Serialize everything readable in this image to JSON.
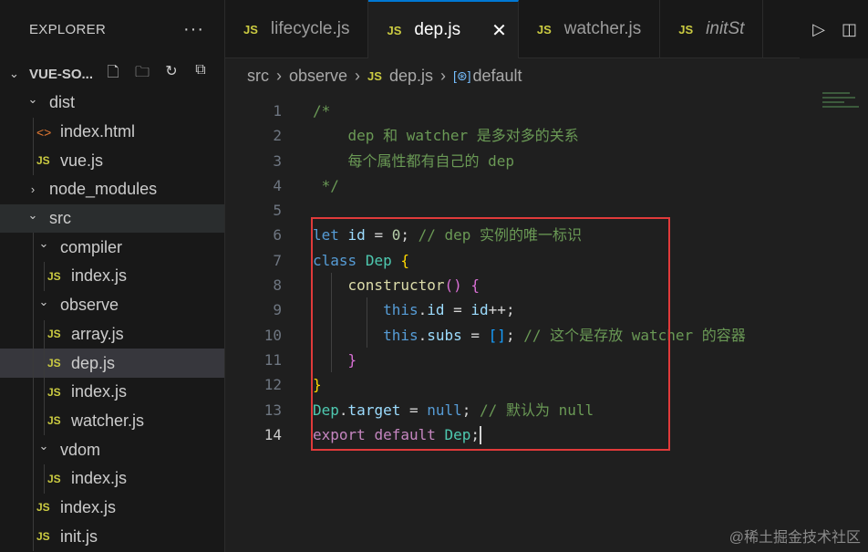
{
  "sidebar": {
    "title": "EXPLORER",
    "more": "···",
    "project": "VUE-SO...",
    "tree": [
      {
        "label": "dist",
        "type": "folder",
        "depth": 0,
        "open": true
      },
      {
        "label": "index.html",
        "type": "html",
        "depth": 1
      },
      {
        "label": "vue.js",
        "type": "js",
        "depth": 1
      },
      {
        "label": "node_modules",
        "type": "folder",
        "depth": 0,
        "open": false
      },
      {
        "label": "src",
        "type": "folder",
        "depth": 0,
        "open": true,
        "hover": true
      },
      {
        "label": "compiler",
        "type": "folder",
        "depth": 1,
        "open": true
      },
      {
        "label": "index.js",
        "type": "js",
        "depth": 2
      },
      {
        "label": "observe",
        "type": "folder",
        "depth": 1,
        "open": true
      },
      {
        "label": "array.js",
        "type": "js",
        "depth": 2
      },
      {
        "label": "dep.js",
        "type": "js",
        "depth": 2,
        "selected": true
      },
      {
        "label": "index.js",
        "type": "js",
        "depth": 2
      },
      {
        "label": "watcher.js",
        "type": "js",
        "depth": 2
      },
      {
        "label": "vdom",
        "type": "folder",
        "depth": 1,
        "open": true
      },
      {
        "label": "index.js",
        "type": "js",
        "depth": 2
      },
      {
        "label": "index.js",
        "type": "js",
        "depth": 1
      },
      {
        "label": "init.js",
        "type": "js",
        "depth": 1
      }
    ]
  },
  "tabs": [
    {
      "label": "lifecycle.js",
      "active": false
    },
    {
      "label": "dep.js",
      "active": true,
      "close": "✕"
    },
    {
      "label": "watcher.js",
      "active": false
    },
    {
      "label": "initSt",
      "active": false,
      "italic": true
    }
  ],
  "js_badge": "JS",
  "html_badge": "<>",
  "breadcrumb": {
    "parts": [
      "src",
      "observe",
      "dep.js"
    ],
    "symbol_icon": "[⊛]",
    "symbol": "default"
  },
  "editor": {
    "current_line": 14,
    "lines": [
      [
        [
          "c-com",
          "/*"
        ]
      ],
      [
        [
          "c-com",
          "    dep 和 watcher 是多对多的关系"
        ]
      ],
      [
        [
          "c-com",
          "    每个属性都有自己的 dep"
        ]
      ],
      [
        [
          "c-com",
          " */"
        ]
      ],
      [],
      [
        [
          "c-kw",
          "let"
        ],
        [
          "c-plain",
          " "
        ],
        [
          "c-var",
          "id"
        ],
        [
          "c-plain",
          " = "
        ],
        [
          "c-num",
          "0"
        ],
        [
          "c-plain",
          "; "
        ],
        [
          "c-com",
          "// dep 实例的唯一标识"
        ]
      ],
      [
        [
          "c-kw",
          "class"
        ],
        [
          "c-plain",
          " "
        ],
        [
          "c-cls",
          "Dep"
        ],
        [
          "c-plain",
          " "
        ],
        [
          "c-b1",
          "{"
        ]
      ],
      [
        [
          "c-plain",
          "    "
        ],
        [
          "c-fn",
          "constructor"
        ],
        [
          "c-b2",
          "()"
        ],
        [
          "c-plain",
          " "
        ],
        [
          "c-b2",
          "{"
        ]
      ],
      [
        [
          "c-plain",
          "        "
        ],
        [
          "c-kw",
          "this"
        ],
        [
          "c-plain",
          "."
        ],
        [
          "c-var",
          "id"
        ],
        [
          "c-plain",
          " = "
        ],
        [
          "c-var",
          "id"
        ],
        [
          "c-plain",
          "++;"
        ]
      ],
      [
        [
          "c-plain",
          "        "
        ],
        [
          "c-kw",
          "this"
        ],
        [
          "c-plain",
          "."
        ],
        [
          "c-var",
          "subs"
        ],
        [
          "c-plain",
          " = "
        ],
        [
          "c-b3",
          "[]"
        ],
        [
          "c-plain",
          "; "
        ],
        [
          "c-com",
          "// 这个是存放 watcher 的容器"
        ]
      ],
      [
        [
          "c-plain",
          "    "
        ],
        [
          "c-b2",
          "}"
        ]
      ],
      [
        [
          "c-b1",
          "}"
        ]
      ],
      [
        [
          "c-cls",
          "Dep"
        ],
        [
          "c-plain",
          "."
        ],
        [
          "c-var",
          "target"
        ],
        [
          "c-plain",
          " = "
        ],
        [
          "c-kw",
          "null"
        ],
        [
          "c-plain",
          "; "
        ],
        [
          "c-com",
          "// 默认为 null"
        ]
      ],
      [
        [
          "c-ctl",
          "export"
        ],
        [
          "c-plain",
          " "
        ],
        [
          "c-ctl",
          "default"
        ],
        [
          "c-plain",
          " "
        ],
        [
          "c-cls",
          "Dep"
        ],
        [
          "c-plain",
          ";"
        ]
      ]
    ]
  },
  "watermark": "@稀土掘金技术社区",
  "colors": {
    "highlight_box": "#e03a3a",
    "accent": "#0078d4"
  }
}
